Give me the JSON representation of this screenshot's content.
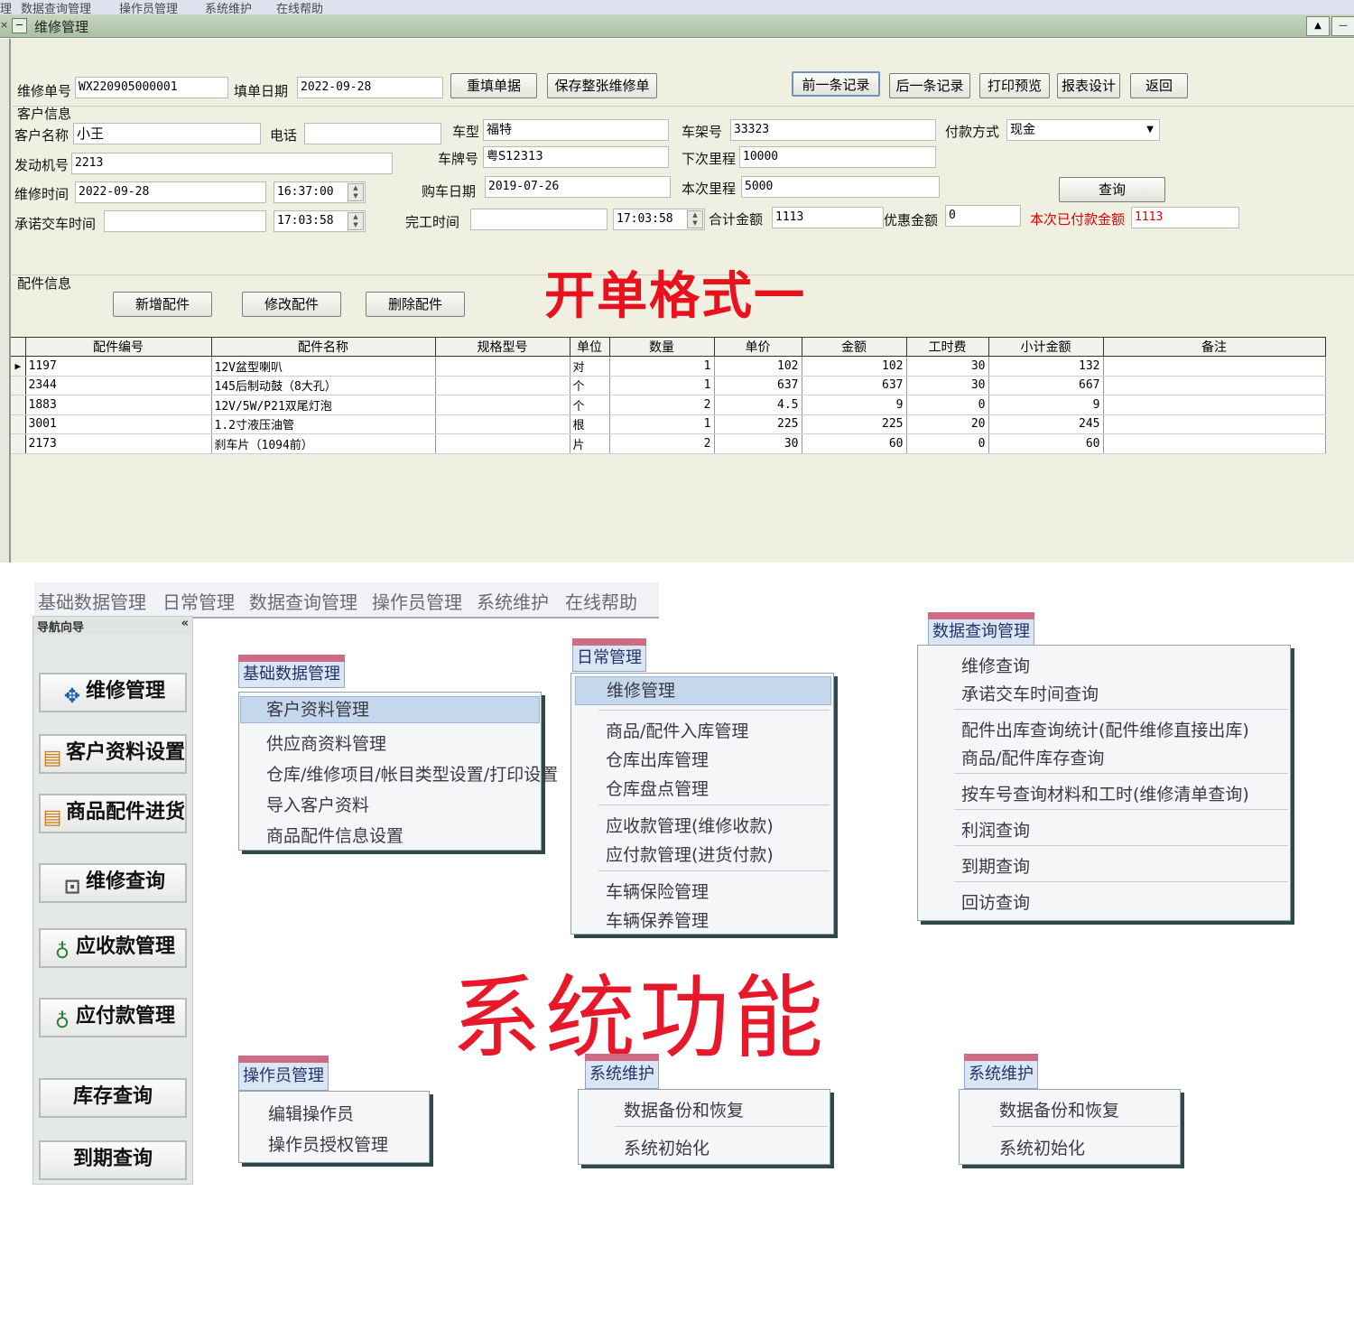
{
  "top_menu": [
    "理",
    "数据查询管理",
    "操作员管理",
    "系统维护",
    "在线帮助"
  ],
  "window": {
    "title": "维修管理",
    "restore_btn": "▲",
    "min_btn": "—"
  },
  "header_row": {
    "order_no_label": "维修单号",
    "order_no": "WX220905000001",
    "date_label": "填单日期",
    "date": "2022-09-28",
    "buttons": {
      "refill": "重填单据",
      "save": "保存整张维修单",
      "prev": "前一条记录",
      "next": "后一条记录",
      "print": "打印预览",
      "report": "报表设计",
      "back": "返回"
    }
  },
  "customer": {
    "section_title": "客户信息",
    "name_label": "客户名称",
    "name": "小王",
    "phone_label": "电话",
    "phone": "",
    "model_label": "车型",
    "model": "福特",
    "frame_label": "车架号",
    "frame": "33323",
    "pay_label": "付款方式",
    "pay": "现金",
    "engine_label": "发动机号",
    "engine": "2213",
    "plate_label": "车牌号",
    "plate": "粤S12313",
    "next_km_label": "下次里程",
    "next_km": "10000",
    "repair_time_label": "维修时间",
    "repair_date": "2022-09-28",
    "repair_time": "16:37:00",
    "buy_date_label": "购车日期",
    "buy_date": "2019-07-26",
    "cur_km_label": "本次里程",
    "cur_km": "5000",
    "query_btn": "查询",
    "promise_label": "承诺交车时间",
    "promise_date": "",
    "promise_time": "17:03:58",
    "finish_label": "完工时间",
    "finish_date": "",
    "finish_time": "17:03:58",
    "total_label": "合计金额",
    "total": "1113",
    "discount_label": "优惠金额",
    "discount": "0",
    "paid_label": "本次已付款金额",
    "paid": "1113"
  },
  "parts_section": {
    "title": "配件信息",
    "add_btn": "新增配件",
    "edit_btn": "修改配件",
    "del_btn": "删除配件",
    "big_label": "开单格式一"
  },
  "parts_columns": [
    "配件编号",
    "配件名称",
    "规格型号",
    "单位",
    "数量",
    "单价",
    "金额",
    "工时费",
    "小计金额",
    "备注"
  ],
  "parts_rows": [
    [
      "1197",
      "12V盆型喇叭",
      "",
      "对",
      "1",
      "102",
      "102",
      "30",
      "132",
      ""
    ],
    [
      "2344",
      "145后制动鼓（8大孔）",
      "",
      "个",
      "1",
      "637",
      "637",
      "30",
      "667",
      ""
    ],
    [
      "1883",
      "12V/5W/P21双尾灯泡",
      "",
      "个",
      "2",
      "4.5",
      "9",
      "0",
      "9",
      ""
    ],
    [
      "3001",
      "1.2寸液压油管",
      "",
      "根",
      "1",
      "225",
      "225",
      "20",
      "245",
      ""
    ],
    [
      "2173",
      "刹车片（1094前）",
      "",
      "片",
      "2",
      "30",
      "60",
      "0",
      "60",
      ""
    ]
  ],
  "main_menu": [
    "基础数据管理",
    "日常管理",
    "数据查询管理",
    "操作员管理",
    "系统维护",
    "在线帮助"
  ],
  "nav": {
    "title": "导航向导",
    "collapse": "«",
    "items": [
      "维修管理",
      "客户资料设置",
      "商品配件进货",
      "维修查询",
      "应收款管理",
      "应付款管理",
      "库存查询",
      "到期查询"
    ]
  },
  "menu_basic": {
    "head": "基础数据管理",
    "items": [
      "客户资料管理",
      "供应商资料管理",
      "仓库/维修项目/帐目类型设置/打印设置",
      "导入客户资料",
      "商品配件信息设置"
    ]
  },
  "menu_daily": {
    "head": "日常管理",
    "items": [
      "维修管理",
      "商品/配件入库管理",
      "仓库出库管理",
      "仓库盘点管理",
      "应收款管理(维修收款)",
      "应付款管理(进货付款)",
      "车辆保险管理",
      "车辆保养管理"
    ]
  },
  "menu_query": {
    "head": "数据查询管理",
    "items": [
      "维修查询",
      "承诺交车时间查询",
      "配件出库查询统计(配件维修直接出库)",
      "商品/配件库存查询",
      "按车号查询材料和工时(维修清单查询)",
      "利润查询",
      "到期查询",
      "回访查询"
    ]
  },
  "menu_operator": {
    "head": "操作员管理",
    "items": [
      "编辑操作员",
      "操作员授权管理"
    ]
  },
  "menu_system_1": {
    "head": "系统维护",
    "items": [
      "数据备份和恢复",
      "系统初始化"
    ]
  },
  "menu_system_2": {
    "head": "系统维护",
    "items": [
      "数据备份和恢复",
      "系统初始化"
    ]
  },
  "big_label_2": "系统功能",
  "colors": {
    "accent_red": "#e8121e",
    "menu_pink": "#d06b85",
    "selection": "#c4d7ec"
  }
}
